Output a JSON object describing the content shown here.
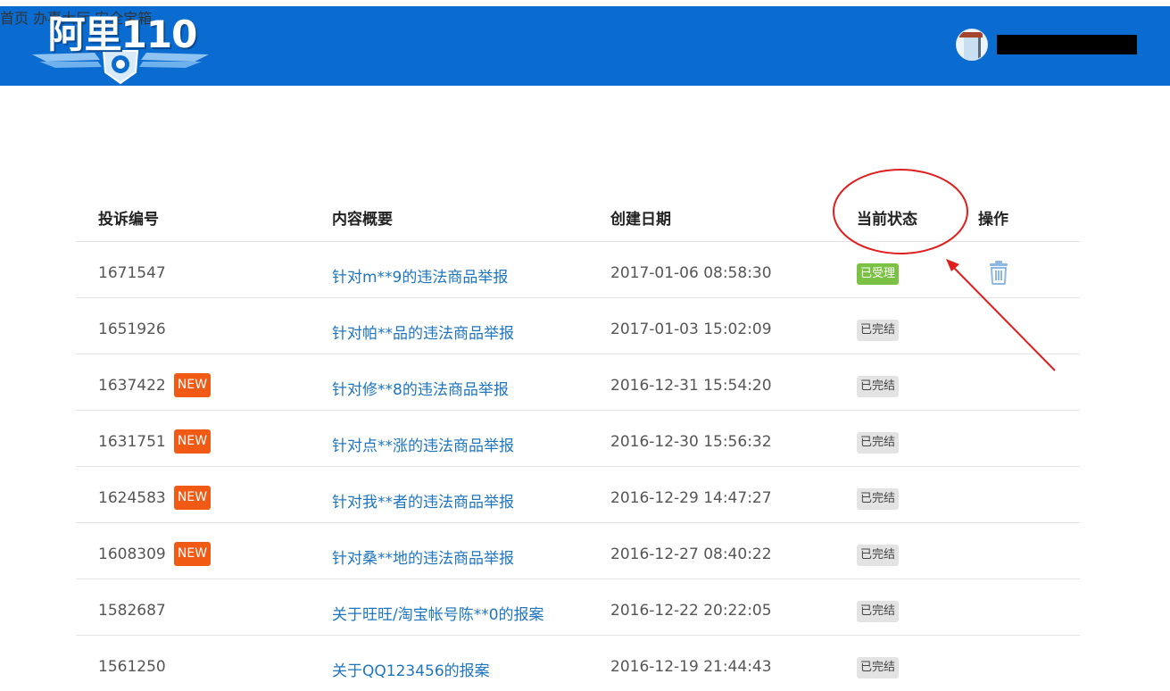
{
  "header": {
    "logo_text": "阿里110",
    "nav": [
      "首页",
      "办事大厅",
      "安全宝箱"
    ],
    "brand_color": "#0a6bd0"
  },
  "table": {
    "columns": [
      "投诉编号",
      "内容概要",
      "创建日期",
      "当前状态",
      "操作"
    ],
    "new_label": "NEW",
    "rows": [
      {
        "id": "1671547",
        "summary": "针对m**9的违法商品举报",
        "date": "2017-01-06 08:58:30",
        "status": "已受理"
      },
      {
        "id": "1651926",
        "summary": "针对帕**品的违法商品举报",
        "date": "2017-01-03 15:02:09",
        "status": "已完结"
      },
      {
        "id": "1637422",
        "summary": "针对修**8的违法商品举报",
        "date": "2016-12-31 15:54:20",
        "status": "已完结"
      },
      {
        "id": "1631751",
        "summary": "针对点**涨的违法商品举报",
        "date": "2016-12-30 15:56:32",
        "status": "已完结"
      },
      {
        "id": "1624583",
        "summary": "针对我**者的违法商品举报",
        "date": "2016-12-29 14:47:27",
        "status": "已完结"
      },
      {
        "id": "1608309",
        "summary": "针对桑**地的违法商品举报",
        "date": "2016-12-27 08:40:22",
        "status": "已完结"
      },
      {
        "id": "1582687",
        "summary": "关于旺旺/淘宝帐号陈**0的报案",
        "date": "2016-12-22 20:22:05",
        "status": "已完结"
      },
      {
        "id": "1561250",
        "summary": "关于QQ123456的报案",
        "date": "2016-12-19 21:44:43",
        "status": "已完结"
      }
    ]
  },
  "colors": {
    "accepted_status": "#7bc144",
    "done_status": "#e3e3e3",
    "new_badge": "#f05a14",
    "link": "#1e75c0",
    "annotation": "#e01e1e"
  }
}
